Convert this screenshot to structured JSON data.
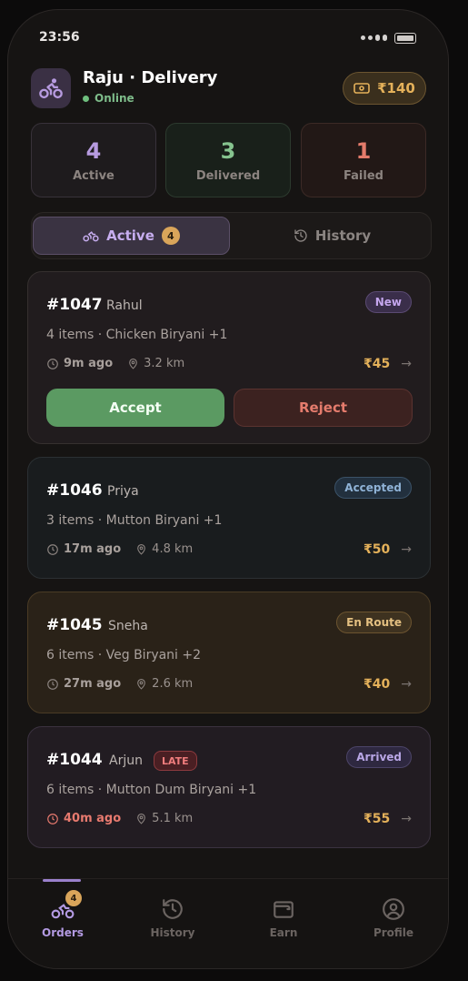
{
  "status_bar": {
    "time": "23:56"
  },
  "header": {
    "name": "Raju · Delivery",
    "status": "Online",
    "wallet": "₹140"
  },
  "stats": [
    {
      "value": "4",
      "label": "Active"
    },
    {
      "value": "3",
      "label": "Delivered"
    },
    {
      "value": "1",
      "label": "Failed"
    }
  ],
  "tabs": {
    "active_label": "Active",
    "active_count": "4",
    "history_label": "History"
  },
  "orders": [
    {
      "id": "#1047",
      "customer": "Rahul",
      "status": "New",
      "items": "4 items · Chicken Biryani +1",
      "ago": "9m ago",
      "distance": "3.2 km",
      "price": "₹45",
      "accept_label": "Accept",
      "reject_label": "Reject"
    },
    {
      "id": "#1046",
      "customer": "Priya",
      "status": "Accepted",
      "items": "3 items · Mutton Biryani +1",
      "ago": "17m ago",
      "distance": "4.8 km",
      "price": "₹50"
    },
    {
      "id": "#1045",
      "customer": "Sneha",
      "status": "En Route",
      "items": "6 items · Veg Biryani +2",
      "ago": "27m ago",
      "distance": "2.6 km",
      "price": "₹40"
    },
    {
      "id": "#1044",
      "customer": "Arjun",
      "flag": "LATE",
      "status": "Arrived",
      "items": "6 items · Mutton Dum Biryani +1",
      "ago": "40m ago",
      "distance": "5.1 km",
      "price": "₹55"
    }
  ],
  "bottom_nav": {
    "items": [
      {
        "label": "Orders",
        "badge": "4"
      },
      {
        "label": "History"
      },
      {
        "label": "Earn"
      },
      {
        "label": "Profile"
      }
    ]
  },
  "colors": {
    "accent_purple": "#b39ae2",
    "success_green": "#5b9a62",
    "danger_red": "#e57c6d",
    "gold": "#e4b15a"
  }
}
